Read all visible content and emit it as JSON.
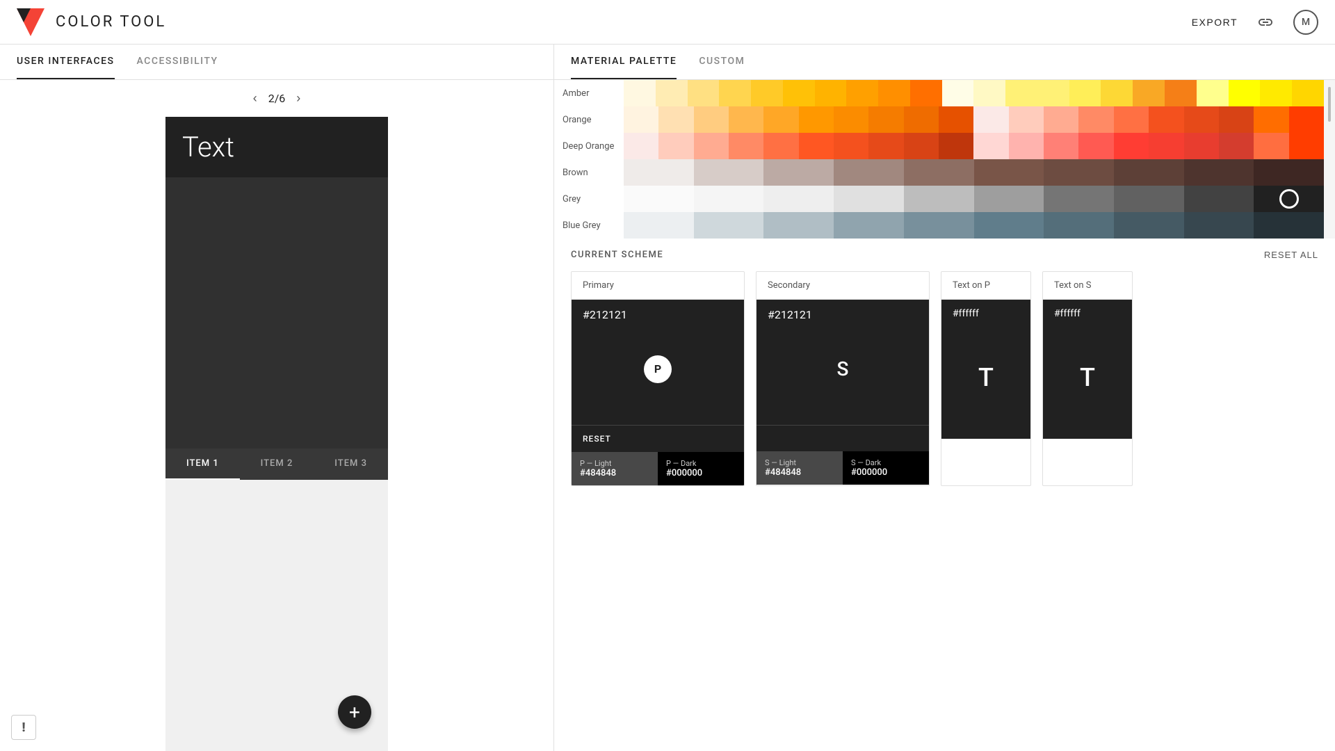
{
  "app": {
    "title": "COLOR  TOOL",
    "export_label": "EXPORT"
  },
  "header": {
    "link_icon": "🔗",
    "avatar_label": "M"
  },
  "left_tabs": [
    {
      "label": "USER INTERFACES",
      "active": true
    },
    {
      "label": "ACCESSIBILITY",
      "active": false
    }
  ],
  "pagination": {
    "current": "2",
    "total": "6",
    "display": "2/6"
  },
  "mock_ui": {
    "text_label": "Text",
    "tabs": [
      {
        "label": "ITEM 1",
        "active": true
      },
      {
        "label": "ITEM 2",
        "active": false
      },
      {
        "label": "ITEM 3",
        "active": false
      }
    ],
    "fab_icon": "+"
  },
  "right_tabs": [
    {
      "label": "MATERIAL PALETTE",
      "active": true
    },
    {
      "label": "CUSTOM",
      "active": false
    }
  ],
  "palette": {
    "rows": [
      {
        "label": "Amber",
        "swatches": [
          "#fff8e1",
          "#ffecb3",
          "#ffe082",
          "#ffd54f",
          "#ffca28",
          "#ffc107",
          "#ffb300",
          "#ffa000",
          "#ff8f00",
          "#ff6f00",
          "#fffde7",
          "#fff9c4",
          "#fff176",
          "#fff176",
          "#ffee58",
          "#fdd835",
          "#f9a825",
          "#f57f17",
          "#ffff8d",
          "#ffff00",
          "#ffea00",
          "#ffd600"
        ]
      },
      {
        "label": "Orange",
        "swatches": [
          "#fff3e0",
          "#ffe0b2",
          "#ffcc80",
          "#ffb74d",
          "#ffa726",
          "#ff9800",
          "#fb8c00",
          "#f57c00",
          "#ef6c00",
          "#e65100",
          "#fbe9e7",
          "#ffccbc",
          "#ffab91",
          "#ff8a65",
          "#ff7043",
          "#f4511e",
          "#e64a19",
          "#d84315",
          "#ff6d00",
          "#ff3d00"
        ]
      },
      {
        "label": "Deep Orange",
        "swatches": [
          "#fbe9e7",
          "#ffccbc",
          "#ffab91",
          "#ff8a65",
          "#ff7043",
          "#ff5722",
          "#f4511e",
          "#e64a19",
          "#d84315",
          "#bf360c",
          "#ffd7d4",
          "#ffb3ae",
          "#ff8076",
          "#ff5a52",
          "#ff3d33",
          "#f63e31",
          "#e83d2f",
          "#d43d2e",
          "#ff6e40",
          "#ff3d00"
        ]
      },
      {
        "label": "Brown",
        "swatches": [
          "#efebe9",
          "#d7ccc8",
          "#bcaaa4",
          "#a1887f",
          "#8d6e63",
          "#795548",
          "#6d4c41",
          "#5d4037",
          "#4e342e",
          "#3e2723"
        ]
      },
      {
        "label": "Grey",
        "swatches": [
          "#fafafa",
          "#f5f5f5",
          "#eeeeee",
          "#e0e0e0",
          "#bdbdbd",
          "#9e9e9e",
          "#757575",
          "#616161",
          "#424242",
          "#212121"
        ]
      },
      {
        "label": "Blue Grey",
        "swatches": [
          "#eceff1",
          "#cfd8dc",
          "#b0bec5",
          "#90a4ae",
          "#78909c",
          "#607d8b",
          "#546e7a",
          "#455a64",
          "#37474f",
          "#263238"
        ]
      }
    ]
  },
  "current_scheme": {
    "title": "CURRENT SCHEME",
    "reset_all_label": "RESET ALL",
    "primary": {
      "label": "Primary",
      "hex": "#212121",
      "circle_label": "P",
      "reset_label": "RESET",
      "light_label": "P — Light",
      "light_hex": "#484848",
      "dark_label": "P — Dark",
      "dark_hex": "#000000"
    },
    "secondary": {
      "label": "Secondary",
      "hex": "#212121",
      "circle_label": "S",
      "light_label": "S — Light",
      "light_hex": "#484848",
      "dark_label": "S — Dark",
      "dark_hex": "#000000"
    },
    "text_on_p": {
      "label": "Text on P",
      "hex": "#ffffff",
      "t_label": "T"
    },
    "text_on_s": {
      "label": "Text on S",
      "hex": "#ffffff",
      "t_label": "T"
    }
  },
  "feedback": {
    "icon": "!"
  }
}
